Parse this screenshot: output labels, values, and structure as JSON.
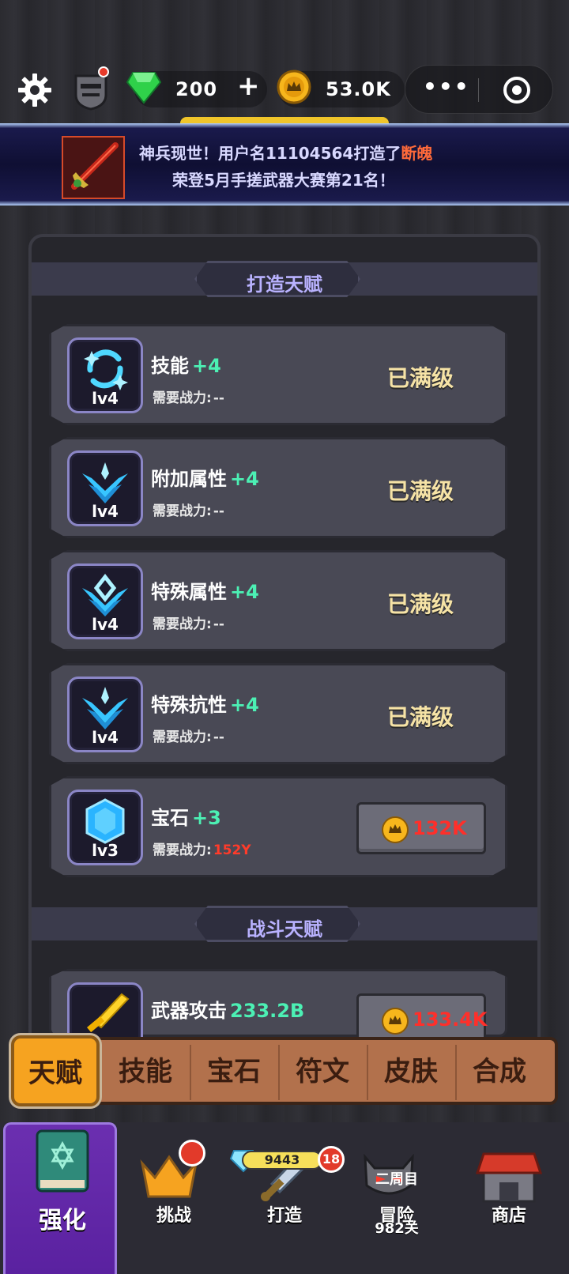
{
  "topbar": {
    "gems": "200",
    "coins": "53.0K",
    "plus": "+",
    "more": "•••"
  },
  "banner": {
    "line1_prefix": "神兵现世！用户名11104564打造了",
    "line1_weapon": "断魄",
    "line2": "荣登5月手搓武器大赛第21名！"
  },
  "forge_section": {
    "title": "打造天赋"
  },
  "forge_talents": [
    {
      "name": "技能",
      "bonus": "+4",
      "level": "lv4",
      "req_label": "需要战力:",
      "req_value": "--",
      "status": "已满级",
      "icon": "swirl-icon"
    },
    {
      "name": "附加属性",
      "bonus": "+4",
      "level": "lv4",
      "req_label": "需要战力:",
      "req_value": "--",
      "status": "已满级",
      "icon": "crest-icon"
    },
    {
      "name": "特殊属性",
      "bonus": "+4",
      "level": "lv4",
      "req_label": "需要战力:",
      "req_value": "--",
      "status": "已满级",
      "icon": "crest-icon"
    },
    {
      "name": "特殊抗性",
      "bonus": "+4",
      "level": "lv4",
      "req_label": "需要战力:",
      "req_value": "--",
      "status": "已满级",
      "icon": "crest-icon"
    },
    {
      "name": "宝石",
      "bonus": "+3",
      "level": "lv3",
      "req_label": "需要战力:",
      "req_value": "152Y",
      "cost": "132K",
      "icon": "gem-icon"
    }
  ],
  "battle_section": {
    "title": "战斗天赋"
  },
  "battle_talents": [
    {
      "name": "武器攻击",
      "bonus": "233.2B",
      "cost": "133.4K",
      "icon": "sword-icon"
    }
  ],
  "subtabs": [
    "天赋",
    "技能",
    "宝石",
    "符文",
    "皮肤",
    "合成"
  ],
  "bottomnav": {
    "items": [
      "强化",
      "挑战",
      "打造",
      "冒险",
      "商店"
    ],
    "forge_count": "9443",
    "forge_badge": "18",
    "adventure_stage": "二周目",
    "adventure_level": "982关"
  },
  "colors": {
    "accent_green": "#4cf0b4",
    "danger_red": "#ff2f2a",
    "maxed_text": "#f6e3a6",
    "active_nav": "#6b2fb0"
  }
}
